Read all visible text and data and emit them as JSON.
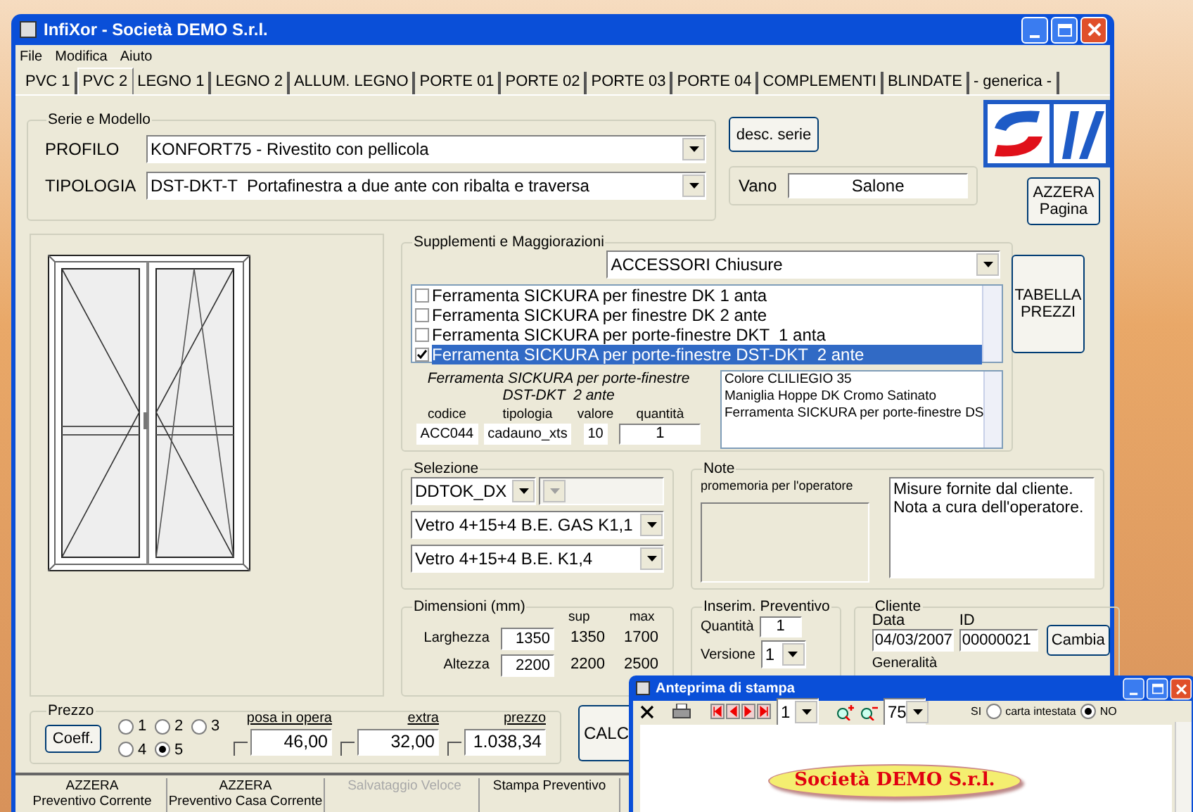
{
  "window": {
    "title": "InfiXor - Società DEMO S.r.l."
  },
  "menu": [
    "File",
    "Modifica",
    "Aiuto"
  ],
  "tabs": [
    {
      "label": "PVC 1",
      "selected": false
    },
    {
      "label": "PVC 2",
      "selected": true
    },
    {
      "label": "LEGNO 1",
      "selected": false
    },
    {
      "label": "LEGNO 2",
      "selected": false
    },
    {
      "label": "ALLUM. LEGNO",
      "selected": false
    },
    {
      "label": "PORTE 01",
      "selected": false
    },
    {
      "label": "PORTE 02",
      "selected": false
    },
    {
      "label": "PORTE 03",
      "selected": false
    },
    {
      "label": "PORTE 04",
      "selected": false
    },
    {
      "label": "COMPLEMENTI",
      "selected": false
    },
    {
      "label": "BLINDATE",
      "selected": false
    },
    {
      "label": "- generica -",
      "selected": false
    }
  ],
  "serie": {
    "title": "Serie e Modello",
    "fields": [
      {
        "label": "PROFILO",
        "value": "KONFORT75 - Rivestito con pellicola"
      },
      {
        "label": "TIPOLOGIA",
        "value": "DST-DKT-T  Portafinestra a due ante con ribalta e traversa"
      }
    ]
  },
  "desc_button": "desc. serie",
  "vano": {
    "label": "Vano",
    "value": "Salone"
  },
  "side_buttons": [
    {
      "lines": [
        "AZZERA",
        "Pagina"
      ]
    },
    {
      "lines": [
        "TABELLA",
        "PREZZI"
      ]
    }
  ],
  "supplementi": {
    "title": "Supplementi e Maggiorazioni",
    "category": "ACCESSORI Chiusure",
    "items": [
      {
        "label": "Ferramenta SICKURA per finestre DK 1 anta",
        "checked": false,
        "selected": false
      },
      {
        "label": "Ferramenta SICKURA per finestre DK 2 ante",
        "checked": false,
        "selected": false
      },
      {
        "label": "Ferramenta SICKURA per porte-finestre DKT  1 anta",
        "checked": false,
        "selected": false
      },
      {
        "label": "Ferramenta SICKURA per porte-finestre DST-DKT  2 ante",
        "checked": true,
        "selected": true
      }
    ],
    "description": "Ferramenta SICKURA per porte-finestre DST-DKT  2 ante",
    "fields": [
      {
        "label": "codice",
        "value": "ACC044",
        "kind": "readonly"
      },
      {
        "label": "tipologia",
        "value": "cadauno_xts",
        "kind": "readonly"
      },
      {
        "label": "valore",
        "value": "10",
        "kind": "readonly"
      },
      {
        "label": "quantità",
        "value": "1",
        "kind": "input"
      }
    ],
    "summary": [
      "Colore CLILIEGIO 35",
      "Maniglia Hoppe DK Cromo Satinato",
      "Ferramenta SICKURA per porte-finestre DS"
    ]
  },
  "selezione": {
    "title": "Selezione",
    "rows": [
      [
        {
          "value": "DDTOK_DX",
          "disabled": false
        },
        {
          "disabled": true
        }
      ],
      [
        {
          "value": "Vetro 4+15+4 B.E. GAS K1,1",
          "disabled": false
        }
      ],
      [
        {
          "value": "Vetro 4+15+4 B.E. K1,4",
          "disabled": false
        }
      ]
    ]
  },
  "note": {
    "title": "Note",
    "memo_label": "promemoria per l'operatore",
    "memo_disabled": true,
    "text": [
      "Misure fornite dal cliente.",
      "Nota a cura dell'operatore."
    ]
  },
  "dimensioni": {
    "title": "Dimensioni (mm)",
    "headers": [
      "sup",
      "max"
    ],
    "rows": [
      {
        "label": "Larghezza",
        "value": "1350",
        "sup": "1350",
        "max": "1700"
      },
      {
        "label": "Altezza",
        "value": "2200",
        "sup": "2200",
        "max": "2500"
      }
    ]
  },
  "inserimento": {
    "title": "Inserim. Preventivo",
    "quantita": {
      "label": "Quantità",
      "value": "1"
    },
    "versione": {
      "label": "Versione",
      "value": "1"
    }
  },
  "cliente": {
    "title": "Cliente",
    "data": {
      "label": "Data",
      "value": "04/03/2007"
    },
    "id": {
      "label": "ID",
      "value": "00000021"
    },
    "button": "Cambia",
    "generalita": "Generalità"
  },
  "prezzo": {
    "title": "Prezzo",
    "button": "Coeff.",
    "options": [
      {
        "label": "1",
        "selected": false
      },
      {
        "label": "2",
        "selected": false
      },
      {
        "label": "3",
        "selected": false
      },
      {
        "label": "4",
        "selected": false
      },
      {
        "label": "5",
        "selected": true
      }
    ],
    "amounts": [
      {
        "label": "posa in opera",
        "value": "46,00",
        "checked": false
      },
      {
        "label": "extra",
        "value": "32,00",
        "checked": false
      },
      {
        "label": "prezzo",
        "value": "1.038,34",
        "checked": false
      }
    ]
  },
  "calc_button": "CALC",
  "bottom_buttons": [
    {
      "lines": [
        "AZZERA",
        "Preventivo Corrente"
      ],
      "disabled": false
    },
    {
      "lines": [
        "AZZERA",
        "Preventivo Casa Corrente"
      ],
      "disabled": false
    },
    {
      "lines": [
        "Salvataggio Veloce"
      ],
      "disabled": true
    },
    {
      "lines": [
        "Stampa Preventivo"
      ],
      "disabled": false
    }
  ],
  "preview": {
    "title": "Anteprima di stampa",
    "page": "1",
    "zoom": "75",
    "letterhead": {
      "caption": "carta intestata",
      "options": [
        {
          "label": "SI",
          "selected": false
        },
        {
          "label": "NO",
          "selected": true
        }
      ]
    },
    "company": "Società DEMO S.r.l."
  }
}
